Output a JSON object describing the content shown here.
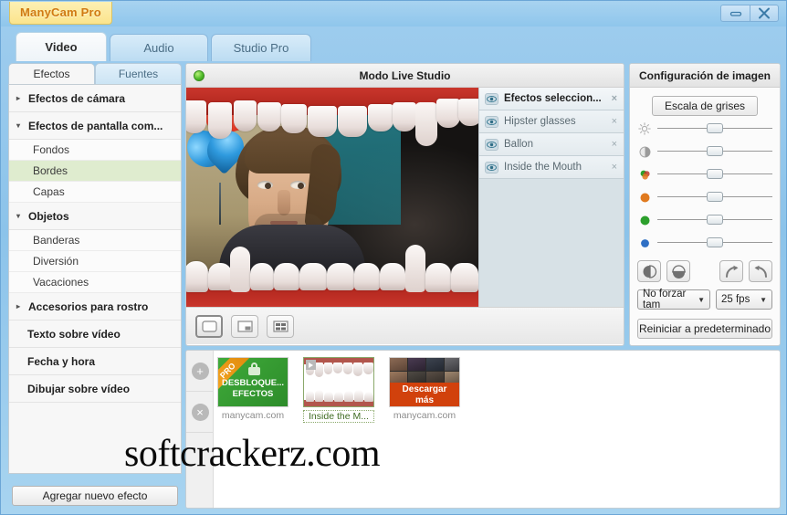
{
  "window": {
    "brand": "ManyCam Pro",
    "minimize_label": "minimize",
    "close_label": "close"
  },
  "main_tabs": [
    {
      "label": "Video",
      "active": true
    },
    {
      "label": "Audio",
      "active": false
    },
    {
      "label": "Studio Pro",
      "active": false
    }
  ],
  "left_panel": {
    "subtabs": [
      {
        "label": "Efectos",
        "active": true
      },
      {
        "label": "Fuentes",
        "active": false
      }
    ],
    "tree": [
      {
        "type": "category",
        "label": "Efectos de cámara",
        "arrow": "▸",
        "expanded": false
      },
      {
        "type": "category",
        "label": "Efectos de pantalla com...",
        "arrow": "▾",
        "expanded": true
      },
      {
        "type": "sub",
        "label": "Fondos",
        "selected": false
      },
      {
        "type": "sub",
        "label": "Bordes",
        "selected": true
      },
      {
        "type": "sub",
        "label": "Capas",
        "selected": false
      },
      {
        "type": "category",
        "label": "Objetos",
        "arrow": "▾",
        "expanded": true
      },
      {
        "type": "sub",
        "label": "Banderas",
        "selected": false
      },
      {
        "type": "sub",
        "label": "Diversión",
        "selected": false
      },
      {
        "type": "sub",
        "label": "Vacaciones",
        "selected": false
      },
      {
        "type": "category",
        "label": "Accesorios para rostro",
        "arrow": "▸",
        "expanded": false
      },
      {
        "type": "plain",
        "label": "Texto sobre vídeo"
      },
      {
        "type": "plain",
        "label": "Fecha y hora"
      },
      {
        "type": "plain",
        "label": "Dibujar sobre vídeo"
      }
    ],
    "add_effect_button": "Agregar nuevo efecto"
  },
  "center_panel": {
    "video_title": "Modo Live Studio",
    "status_indicator": "live-green",
    "view_modes": [
      {
        "name": "single-view",
        "active": true
      },
      {
        "name": "picture-in-picture-view",
        "active": false
      },
      {
        "name": "quad-view",
        "active": false
      }
    ]
  },
  "selected_effects": {
    "header": "Efectos seleccion...",
    "items": [
      {
        "label": "Efectos seleccion...",
        "visible": true,
        "close": "×"
      },
      {
        "label": "Hipster glasses",
        "visible": true,
        "close": "×"
      },
      {
        "label": "Ballon",
        "visible": true,
        "close": "×"
      },
      {
        "label": "Inside the Mouth",
        "visible": true,
        "close": "×"
      }
    ]
  },
  "right_panel": {
    "title": "Configuración de imagen",
    "grayscale_button": "Escala de grises",
    "sliders": [
      {
        "name": "brightness",
        "icon": "sun-icon",
        "value": 50,
        "color": "#b0b0b0"
      },
      {
        "name": "contrast",
        "icon": "contrast-icon",
        "value": 50,
        "color": "#9a9a9a"
      },
      {
        "name": "saturation",
        "icon": "saturation-icon",
        "value": 50,
        "color": "#4a9b3c"
      },
      {
        "name": "red",
        "icon": "red-dot-icon",
        "value": 50,
        "color": "#e07a1f"
      },
      {
        "name": "green",
        "icon": "green-dot-icon",
        "value": 50,
        "color": "#2da02d"
      },
      {
        "name": "blue",
        "icon": "blue-dot-icon",
        "value": 50,
        "color": "#2e6fc4"
      }
    ],
    "tool_buttons": [
      {
        "name": "flip-horizontal-button",
        "icon": "flip-horizontal-icon"
      },
      {
        "name": "flip-vertical-button",
        "icon": "flip-vertical-icon"
      },
      {
        "name": "rotate-right-button",
        "icon": "rotate-right-icon"
      },
      {
        "name": "rotate-left-button",
        "icon": "rotate-left-icon"
      }
    ],
    "size_select": {
      "value": "No forzar tam",
      "caret": "▼"
    },
    "fps_select": {
      "value": "25 fps",
      "caret": "▼"
    },
    "reset_button": "Reiniciar a predeterminado"
  },
  "bottom_panel": {
    "add_button": "+",
    "remove_button": "×",
    "thumbnails": [
      {
        "name": "unlock-effects-promo",
        "badge": "PRO",
        "line1": "DESBLOQUE...",
        "line2": "EFECTOS",
        "caption": "manycam.com",
        "selected": false
      },
      {
        "name": "inside-the-mouth-effect",
        "caption": "Inside the M...",
        "selected": true
      },
      {
        "name": "download-more-effects",
        "line1": "Descargar",
        "line2": "más",
        "caption": "manycam.com",
        "selected": false
      }
    ]
  },
  "watermark": {
    "text": "softcrackerz.com"
  }
}
